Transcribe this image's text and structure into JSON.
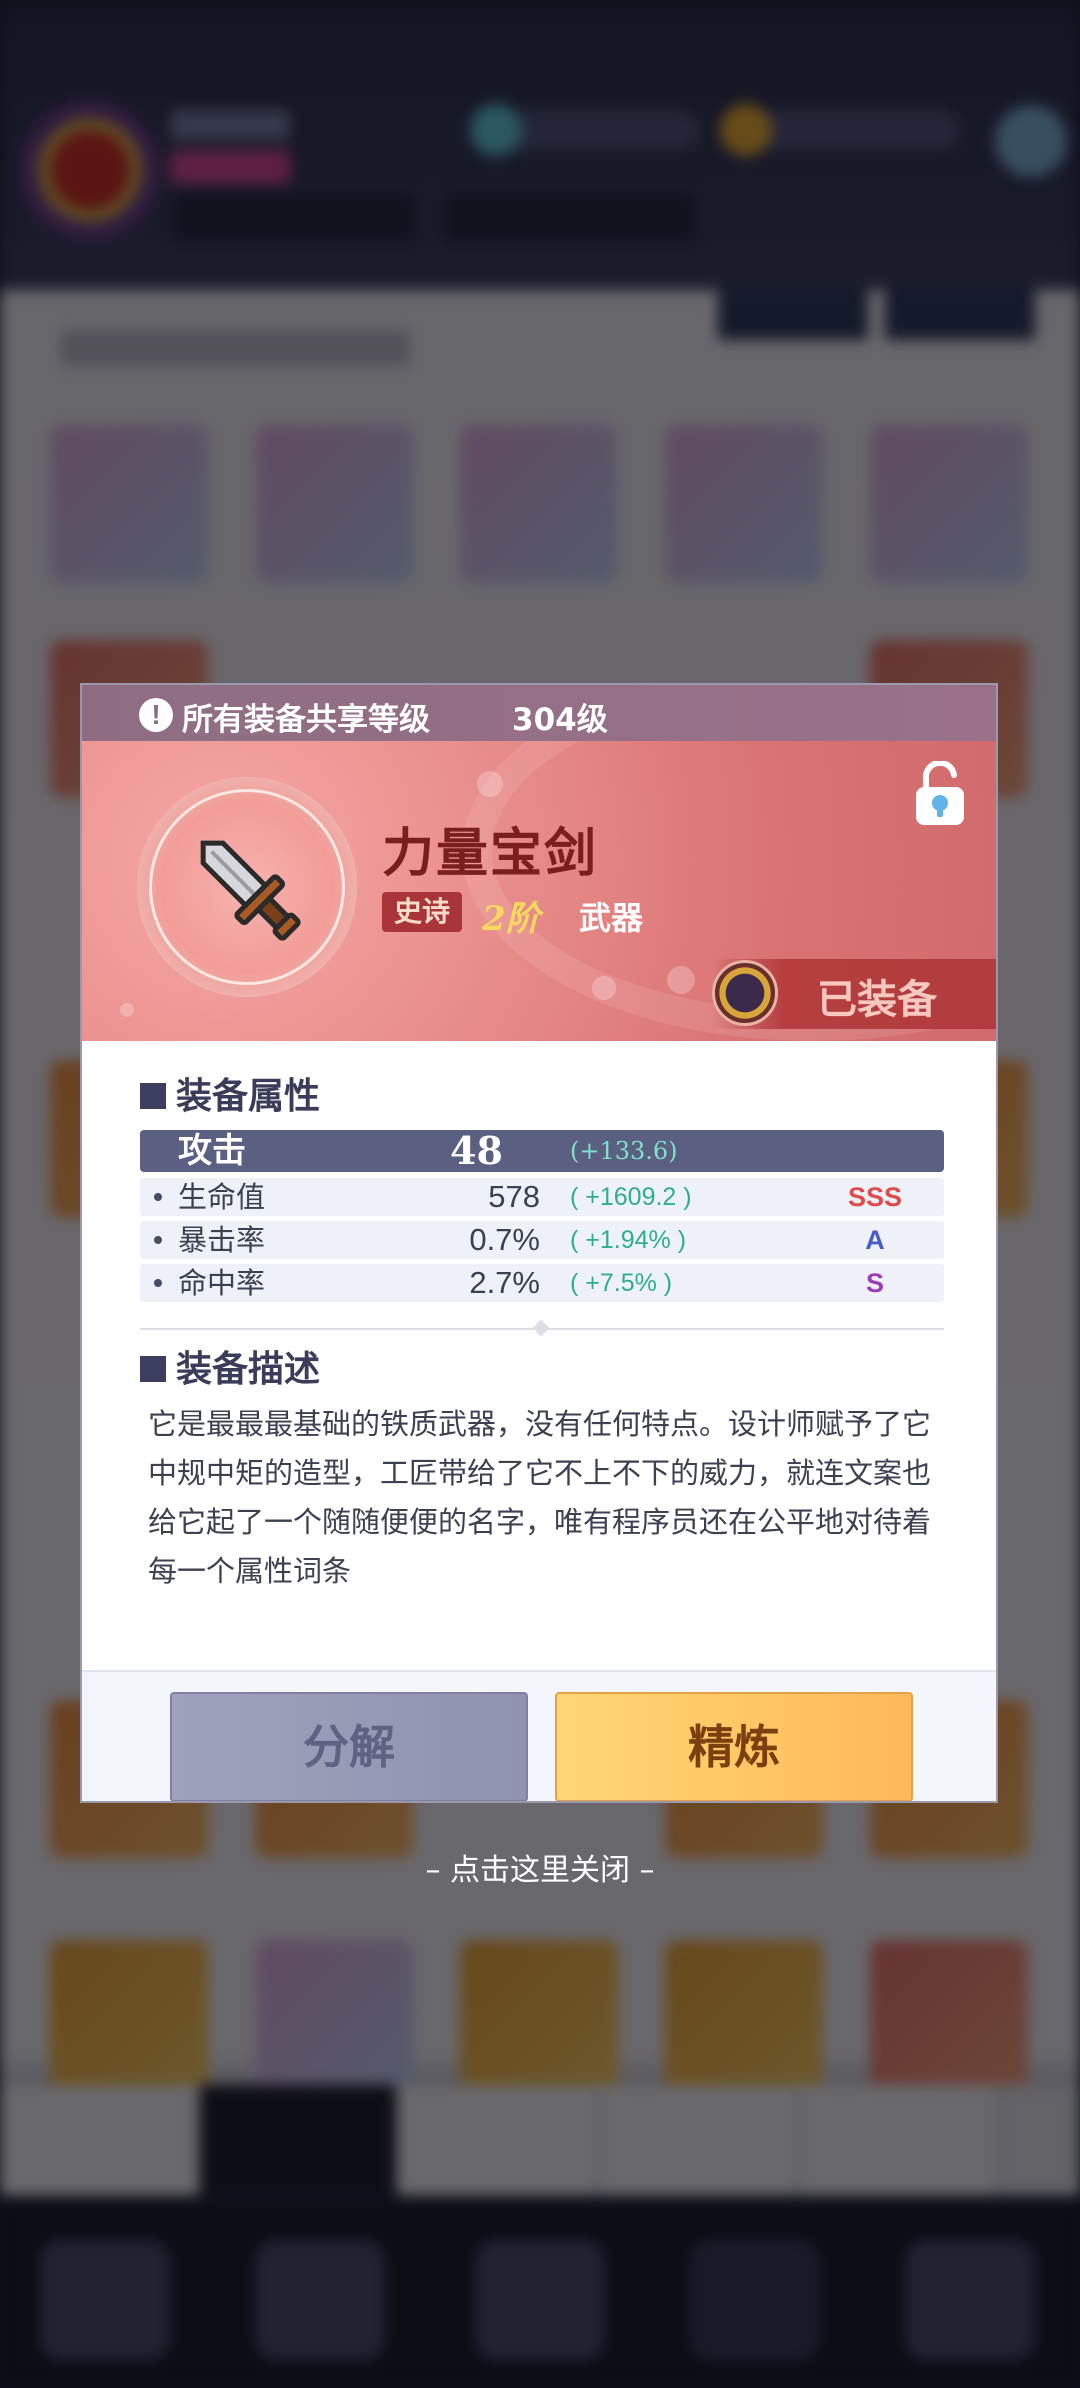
{
  "dialog": {
    "level_notice": "所有装备共享等级",
    "level_value": "304级",
    "item": {
      "name": "力量宝剑",
      "rarity": "史诗",
      "tier": "2阶",
      "type": "武器",
      "equipped_label": "已装备",
      "icon": "sword-icon"
    },
    "attributes_title": "装备属性",
    "main_attribute": {
      "name": "攻击",
      "value": "48",
      "bonus": "(+133.6)"
    },
    "sub_attributes": [
      {
        "name": "生命值",
        "value": "578",
        "bonus": "( +1609.2 )",
        "grade": "SSS",
        "grade_color": "#e04a4a"
      },
      {
        "name": "暴击率",
        "value": "0.7%",
        "bonus": "( +1.94% )",
        "grade": "A",
        "grade_color": "#4a5cc8"
      },
      {
        "name": "命中率",
        "value": "2.7%",
        "bonus": "( +7.5% )",
        "grade": "S",
        "grade_color": "#9a3fb8"
      }
    ],
    "description_title": "装备描述",
    "description": "它是最最最基础的铁质武器，没有任何特点。设计师赋予了它中规中矩的造型，工匠带给了它不上不下的威力，就连文案也给它起了一个随随便便的名字，唯有程序员还在公平地对待着每一个属性词条",
    "buttons": {
      "decompose": "分解",
      "refine": "精炼"
    }
  },
  "close_hint": "– 点击这里关闭 –",
  "colors": {
    "header_red": "#d97373",
    "refine_yellow": "#ffc764",
    "decompose_gray": "#9a9db8"
  }
}
